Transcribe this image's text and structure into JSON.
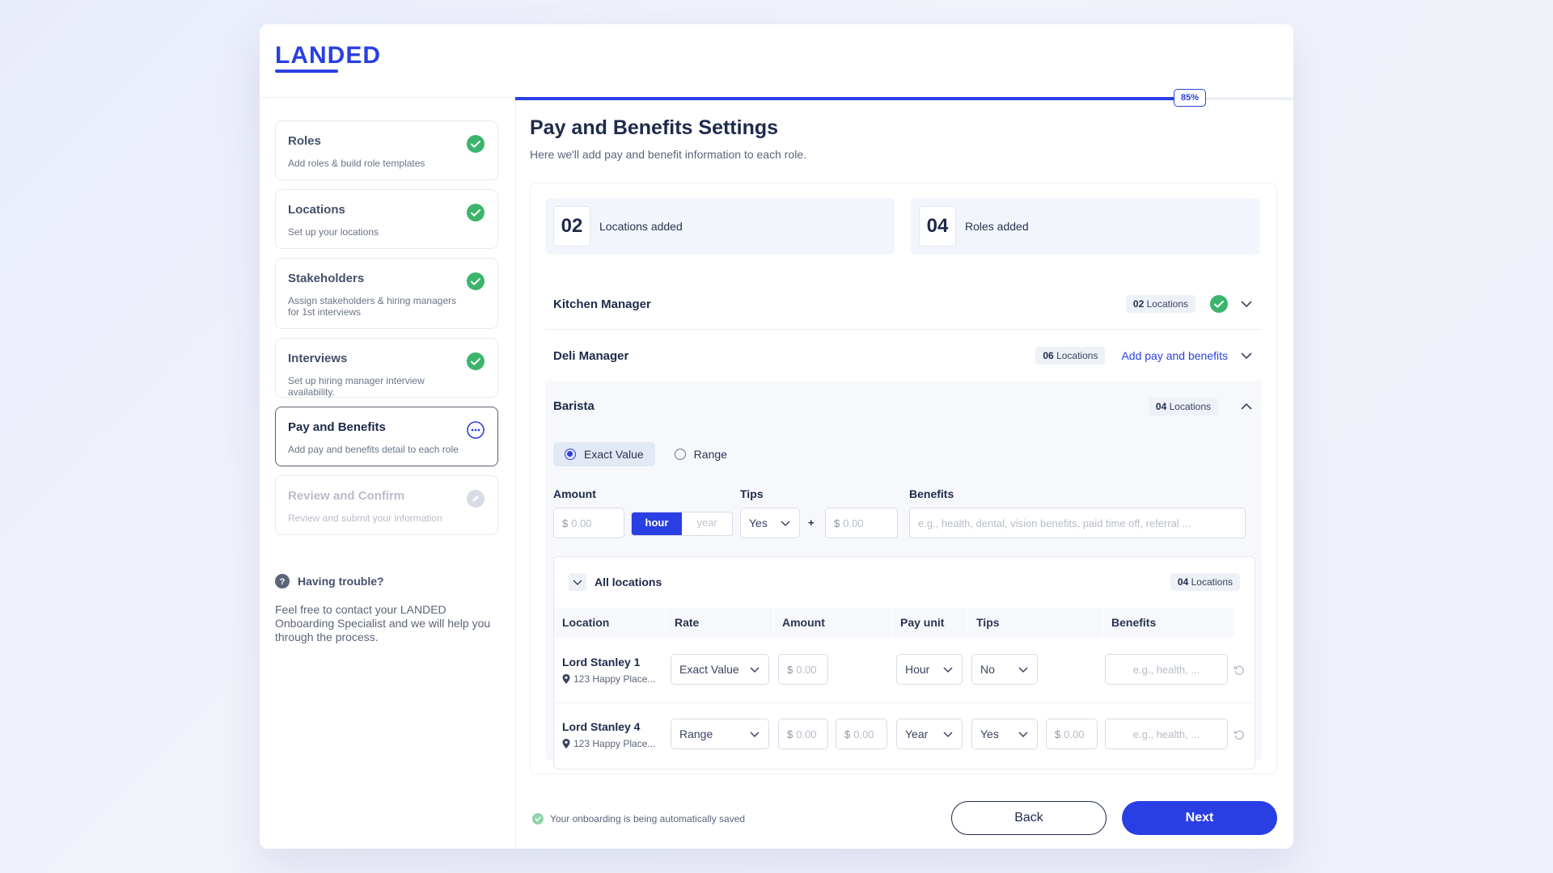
{
  "app": {
    "logo": "LANDED"
  },
  "progress": {
    "percent": 85,
    "label": "85%"
  },
  "steps": [
    {
      "title": "Roles",
      "desc": "Add roles & build role templates",
      "status": "done"
    },
    {
      "title": "Locations",
      "desc": "Set up your locations",
      "status": "done"
    },
    {
      "title": "Stakeholders",
      "desc": "Assign stakeholders & hiring managers for 1st interviews",
      "status": "done"
    },
    {
      "title": "Interviews",
      "desc": "Set up hiring manager interview availability.",
      "status": "done"
    },
    {
      "title": "Pay and Benefits",
      "desc": "Add pay and benefits detail to each role",
      "status": "active"
    },
    {
      "title": "Review and Confirm",
      "desc": "Review and submit your information",
      "status": "disabled"
    }
  ],
  "help": {
    "title": "Having trouble?",
    "body": "Feel free to contact your LANDED Onboarding Specialist and we will help you through the process."
  },
  "page": {
    "title": "Pay and Benefits Settings",
    "subtitle": "Here we'll add pay and benefit information to each role."
  },
  "stats": [
    {
      "num": "02",
      "label": "Locations added"
    },
    {
      "num": "04",
      "label": "Roles added"
    }
  ],
  "roles": [
    {
      "name": "Kitchen Manager",
      "count": "02",
      "count_label": "Locations",
      "status": "done"
    },
    {
      "name": "Deli Manager",
      "count": "06",
      "count_label": "Locations",
      "action": "Add pay and benefits"
    },
    {
      "name": "Barista",
      "count": "04",
      "count_label": "Locations",
      "expanded": true
    }
  ],
  "barista": {
    "mode_options": [
      "Exact Value",
      "Range"
    ],
    "selected_mode": "Exact Value",
    "labels": {
      "amount": "Amount",
      "tips": "Tips",
      "benefits": "Benefits"
    },
    "amount_prefix": "$",
    "amount_placeholder": "0.00",
    "unit_options": [
      "hour",
      "year"
    ],
    "selected_unit": "hour",
    "tips_value": "Yes",
    "plus": "+",
    "tips_amount_placeholder": "0.00",
    "benefits_placeholder": "e.g., health, dental, vision benefits, paid time off, referral ..."
  },
  "locations_table": {
    "title": "All locations",
    "count": "04",
    "count_label": "Locations",
    "columns": [
      "Location",
      "Rate",
      "Amount",
      "Pay unit",
      "Tips",
      "Benefits"
    ],
    "rows": [
      {
        "name": "Lord Stanley 1",
        "address": "123 Happy Place...",
        "rate": "Exact Value",
        "amount_placeholder": "0.00",
        "pay_unit": "Hour",
        "tips": "No",
        "benefits_placeholder": "e.g., health, ..."
      },
      {
        "name": "Lord Stanley 4",
        "address": "123 Happy Place...",
        "rate": "Range",
        "amount_min_placeholder": "0.00",
        "amount_max_placeholder": "0.00",
        "pay_unit": "Year",
        "tips": "Yes",
        "tips_amount_placeholder": "0.00",
        "benefits_placeholder": "e.g., health, ..."
      }
    ]
  },
  "footer": {
    "saved_text": "Your onboarding is being automatically saved",
    "back_label": "Back",
    "next_label": "Next"
  },
  "colors": {
    "accent": "#2a3fe3",
    "success": "#3bb56b",
    "text": "#1e2a4a"
  }
}
